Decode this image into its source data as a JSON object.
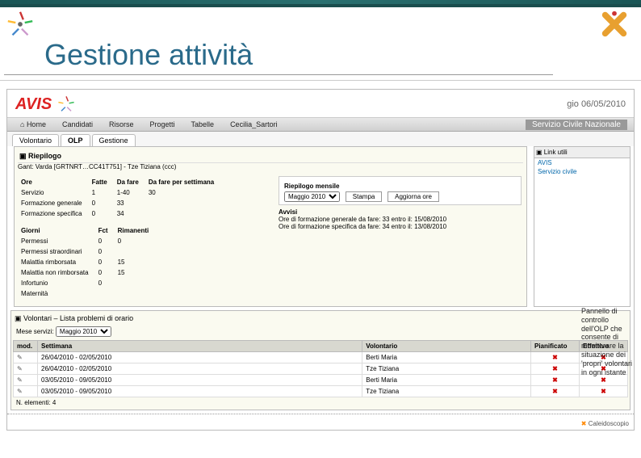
{
  "slide": {
    "title": "Gestione attività"
  },
  "header": {
    "date": "gio 06/05/2010",
    "logo_text": "AVIS",
    "service_label": "Servizio Civile Nazionale"
  },
  "nav": {
    "home": "Home",
    "items": [
      "Candidati",
      "Risorse",
      "Progetti",
      "Tabelle",
      "Cecilia_Sartori"
    ]
  },
  "subtabs": {
    "t0": "Volontario",
    "t1": "OLP",
    "t2": "Gestione"
  },
  "riepilogo": {
    "title": "Riepilogo",
    "gant": "Gant: Varda [GRTNRT…CC41T751] - Tze Tiziana (ccc)",
    "ore_head": "Ore",
    "fatte": "Fatte",
    "dafare": "Da fare",
    "dafare_set": "Da fare per settimana",
    "rows_ore": [
      {
        "label": "Servizio",
        "fatte": "1",
        "dafare": "1-40",
        "set": "30"
      },
      {
        "label": "Formazione generale",
        "fatte": "0",
        "dafare": "33",
        "set": ""
      },
      {
        "label": "Formazione specifica",
        "fatte": "0",
        "dafare": "34",
        "set": ""
      }
    ],
    "giorni_head": "Giorni",
    "fct": "Fct",
    "rim": "Rimanenti",
    "rows_giorni": [
      {
        "label": "Permessi",
        "fct": "0",
        "rim": "0"
      },
      {
        "label": "Permessi straordinari",
        "fct": "0",
        "rim": ""
      },
      {
        "label": "Malattia rimborsata",
        "fct": "0",
        "rim": "15"
      },
      {
        "label": "Malattia non rimborsata",
        "fct": "0",
        "rim": "15"
      },
      {
        "label": "Infortunio",
        "fct": "0",
        "rim": ""
      },
      {
        "label": "Maternità",
        "fct": "",
        "rim": ""
      }
    ],
    "mensile_title": "Riepilogo mensile",
    "mese_val": "Maggio 2010",
    "btn_stampa": "Stampa",
    "btn_agg": "Aggiorna ore",
    "avvisi_label": "Avvisi",
    "avvisi": [
      "Ore di formazione generale da fare: 33   entro il: 15/08/2010",
      "Ore di formazione specifica da fare: 34   entro il: 13/08/2010"
    ]
  },
  "linkutili": {
    "title": "Link utili",
    "links": [
      "AVIS",
      "Servizio civile"
    ]
  },
  "volontari": {
    "title": "Volontari – Lista problemi di orario",
    "mese_label": "Mese servizi:",
    "mese_val": "Maggio 2010",
    "cols": {
      "mod": "mod.",
      "sett": "Settimana",
      "vol": "Volontario",
      "pian": "Pianificato",
      "eff": "Effettivo"
    },
    "rows": [
      {
        "sett": "26/04/2010 - 02/05/2010",
        "vol": "Berti Maria"
      },
      {
        "sett": "26/04/2010 - 02/05/2010",
        "vol": "Tze Tiziana"
      },
      {
        "sett": "03/05/2010 - 09/05/2010",
        "vol": "Berti Maria"
      },
      {
        "sett": "03/05/2010 - 09/05/2010",
        "vol": "Tze Tiziana"
      }
    ],
    "count": "N. elementi: 4"
  },
  "footer": {
    "brand": "Caleidoscopio"
  },
  "note": {
    "text": "Pannello di controllo dell'OLP che consente di monitorare la situazione dei 'propri' volontari in ogni istante"
  }
}
